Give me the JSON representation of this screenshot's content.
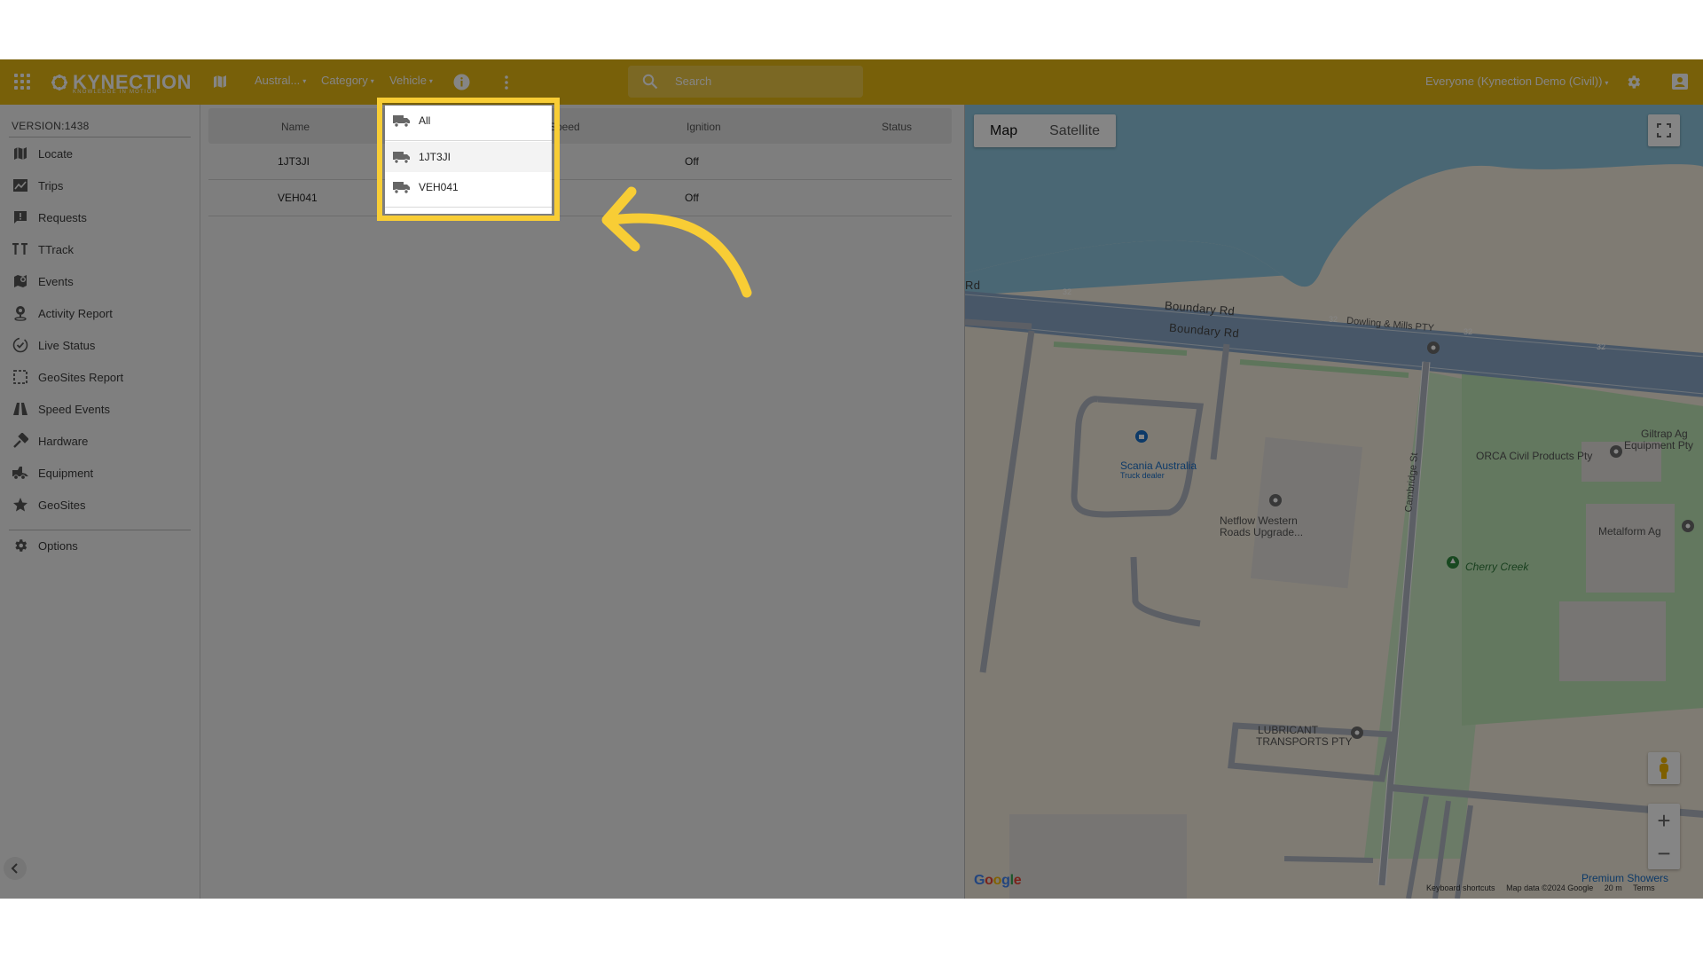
{
  "header": {
    "brand": "KYNECTION",
    "tagline": "KNOWLEDGE IN MOTION",
    "region_filter": "Austral...",
    "category_filter": "Category",
    "vehicle_filter": "Vehicle",
    "search_placeholder": "Search",
    "user_group": "Everyone (Kynection Demo (Civil))",
    "brand_color": "#e7b913"
  },
  "sidebar": {
    "version": "VERSION:1438",
    "items": [
      {
        "label": "Locate",
        "icon": "map-icon"
      },
      {
        "label": "Trips",
        "icon": "trips-icon"
      },
      {
        "label": "Requests",
        "icon": "requests-icon"
      },
      {
        "label": "TTrack",
        "icon": "ttrack-icon"
      },
      {
        "label": "Events",
        "icon": "events-icon"
      },
      {
        "label": "Activity Report",
        "icon": "person-pin-icon"
      },
      {
        "label": "Live Status",
        "icon": "live-status-icon"
      },
      {
        "label": "GeoSites Report",
        "icon": "geosites-report-icon"
      },
      {
        "label": "Speed Events",
        "icon": "road-icon"
      },
      {
        "label": "Hardware",
        "icon": "hardware-icon"
      },
      {
        "label": "Equipment",
        "icon": "equipment-icon"
      },
      {
        "label": "GeoSites",
        "icon": "star-icon"
      }
    ],
    "options_label": "Options"
  },
  "table": {
    "columns": [
      "Name",
      "Speed",
      "Ignition",
      "Status"
    ],
    "rows": [
      {
        "name": "1JT3JI",
        "ignition": "Off"
      },
      {
        "name": "VEH041",
        "ignition": "Off"
      }
    ]
  },
  "vehicle_dropdown": {
    "items": [
      "All",
      "1JT3JI",
      "VEH041"
    ],
    "highlight_color": "#f8cd35"
  },
  "map": {
    "type_buttons": [
      "Map",
      "Satellite"
    ],
    "active_type": "Map",
    "labels": {
      "road1": "Boundary Rd",
      "road2": "Boundary Rd",
      "road3": "Rd",
      "route_shield": "32",
      "street_cambridge": "Cambridge St",
      "poi_dowling": "Dowling & Mills PTY",
      "poi_scania": "Scania Australia",
      "poi_scania_sub": "Truck dealer",
      "poi_netflow": "Netflow Western",
      "poi_netflow2": "Roads Upgrade...",
      "poi_orca": "ORCA Civil Products Pty",
      "poi_giltrap": "Giltrap Ag",
      "poi_giltrap2": "Equipment Pty",
      "poi_metalform": "Metalform Ag",
      "poi_cherry": "Cherry Creek",
      "poi_lubricant": "LUBRICANT",
      "poi_lubricant2": "TRANSPORTS PTY",
      "poi_premium": "Premium Showers"
    },
    "footer": {
      "google": "Google",
      "shortcuts": "Keyboard shortcuts",
      "map_data": "Map data ©2024 Google",
      "scale": "20 m",
      "terms": "Terms"
    }
  }
}
